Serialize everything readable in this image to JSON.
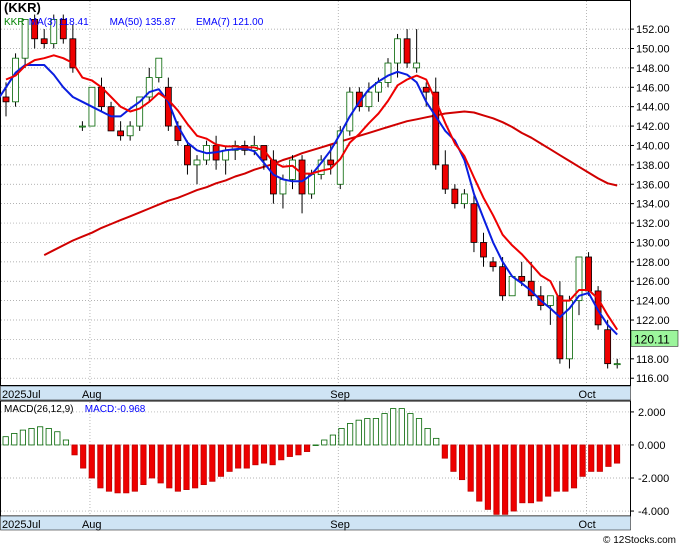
{
  "chart_data": [
    {
      "type": "candlestick",
      "title": "(KKR)",
      "symbol": "KKR",
      "legend": [
        {
          "label": "KKR",
          "color": "#008000"
        },
        {
          "label": "MA(3)",
          "value": "118.41",
          "color": "#0000ff"
        },
        {
          "label": "MA(50)",
          "value": "135.87",
          "color": "#0000ff"
        },
        {
          "label": "EMA(7)",
          "value": "121.00",
          "color": "#0000ff"
        }
      ],
      "last_price": "120.11",
      "y_ticks": [
        "152.00",
        "150.00",
        "148.00",
        "146.00",
        "144.00",
        "142.00",
        "140.00",
        "138.00",
        "136.00",
        "134.00",
        "132.00",
        "130.00",
        "128.00",
        "126.00",
        "124.00",
        "122.00",
        "120.00",
        "118.00",
        "116.00"
      ],
      "ylim": [
        115.3,
        155.0
      ],
      "x_labels": [
        {
          "label": "2025Jul",
          "i": 0
        },
        {
          "label": "Aug",
          "i": 9
        },
        {
          "label": "Sep",
          "i": 35
        },
        {
          "label": "Oct",
          "i": 61
        }
      ],
      "candles": [
        [
          145,
          146.5,
          143,
          144.5
        ],
        [
          144.5,
          149.5,
          144,
          149
        ],
        [
          149,
          153,
          148,
          153
        ],
        [
          153,
          153.5,
          150,
          151
        ],
        [
          151,
          152,
          150,
          150.5
        ],
        [
          150.5,
          153.5,
          150,
          153
        ],
        [
          153,
          153.5,
          150.5,
          151
        ],
        [
          151,
          152.5,
          147.5,
          148
        ],
        [
          142,
          142.5,
          141.5,
          142
        ],
        [
          142,
          146,
          142,
          146
        ],
        [
          146,
          147,
          143.5,
          144
        ],
        [
          144,
          144.5,
          141.5,
          141.5
        ],
        [
          141.5,
          142.5,
          140.5,
          141
        ],
        [
          141,
          142.5,
          140.5,
          142
        ],
        [
          142,
          145,
          141.5,
          145
        ],
        [
          145,
          148,
          144.5,
          147
        ],
        [
          147,
          149,
          146.5,
          149
        ],
        [
          146,
          147,
          141.5,
          142
        ],
        [
          142,
          142.5,
          140,
          140.5
        ],
        [
          140,
          140.5,
          137,
          138
        ],
        [
          138,
          139,
          136,
          138.5
        ],
        [
          138.5,
          140.5,
          138,
          140
        ],
        [
          140,
          141,
          137.5,
          138.5
        ],
        [
          138.5,
          140,
          137,
          139.5
        ],
        [
          139.5,
          140.5,
          138.5,
          140
        ],
        [
          140,
          140.5,
          139,
          139.5
        ],
        [
          139.5,
          141,
          139,
          140
        ],
        [
          140,
          140,
          137.5,
          138.5
        ],
        [
          138.5,
          139.5,
          134,
          135
        ],
        [
          135,
          137,
          133.5,
          136.5
        ],
        [
          136.5,
          139,
          135.5,
          138.5
        ],
        [
          138.5,
          139,
          133,
          135
        ],
        [
          135,
          137.5,
          134.5,
          137
        ],
        [
          137,
          139,
          136.5,
          138.5
        ],
        [
          138.5,
          140,
          137,
          138
        ],
        [
          136,
          142,
          135.5,
          141.5
        ],
        [
          141.5,
          146,
          141,
          145.5
        ],
        [
          145.5,
          146,
          143.5,
          144
        ],
        [
          144,
          146.5,
          143.5,
          145.5
        ],
        [
          145.5,
          147,
          144.5,
          146.5
        ],
        [
          146.5,
          149,
          146,
          148.5
        ],
        [
          148.5,
          151.5,
          147,
          151
        ],
        [
          151,
          152,
          148,
          148.5
        ],
        [
          148,
          152,
          147.5,
          148.5
        ],
        [
          146,
          146.5,
          144,
          145.5
        ],
        [
          145.5,
          147,
          137.5,
          138
        ],
        [
          138,
          139.5,
          135,
          135.5
        ],
        [
          135.5,
          136,
          133.5,
          134
        ],
        [
          134,
          135.5,
          133.5,
          135
        ],
        [
          134,
          135,
          129,
          130
        ],
        [
          130,
          131,
          127.5,
          128.5
        ],
        [
          128,
          128.5,
          127,
          127.5
        ],
        [
          127.5,
          128.5,
          124,
          124.5
        ],
        [
          124.5,
          126.5,
          124.5,
          126.5
        ],
        [
          126.5,
          128,
          125.5,
          126
        ],
        [
          126,
          128,
          124,
          124.5
        ],
        [
          124.5,
          125.5,
          123,
          123.5
        ],
        [
          123.5,
          124.5,
          121.5,
          124.5
        ],
        [
          124.5,
          126,
          117.5,
          118
        ],
        [
          118,
          124.5,
          117,
          124
        ],
        [
          124,
          128.5,
          122.5,
          128.5
        ],
        [
          128.5,
          129,
          124.5,
          125
        ],
        [
          125,
          125.5,
          121,
          121.5
        ],
        [
          121,
          122,
          117,
          117.5
        ],
        [
          117.5,
          118,
          117,
          117.5
        ]
      ],
      "ma3": [
        144.5,
        146,
        147.5,
        148.3,
        148.3,
        148.3,
        147.3,
        146,
        145,
        144.5,
        144,
        143.5,
        143,
        143,
        143.8,
        144.5,
        145.5,
        145.8,
        144.5,
        142,
        140.3,
        139.5,
        139.2,
        139.3,
        139.5,
        139.6,
        139.7,
        139.4,
        138.2,
        137,
        136.5,
        136.3,
        136.3,
        137,
        138.2,
        139.5,
        141.2,
        143,
        144.5,
        145.8,
        146.6,
        147.2,
        147.6,
        147.3,
        146.5,
        144.5,
        143,
        141.5,
        140.5,
        138.5,
        135,
        132.5,
        130,
        128,
        126.5,
        125.8,
        125,
        124,
        123.2,
        122.3,
        123.2,
        124.5,
        124.8,
        123,
        121.5,
        120.5
      ],
      "ma50": [
        128.7,
        129.2,
        129.7,
        130.2,
        130.6,
        131,
        131.5,
        131.9,
        132.3,
        132.7,
        133.1,
        133.5,
        133.9,
        134.3,
        134.6,
        135,
        135.4,
        135.7,
        136.1,
        136.4,
        136.8,
        137.1,
        137.5,
        137.8,
        138.1,
        138.5,
        138.8,
        139.2,
        139.5,
        139.8,
        140.1,
        140.4,
        140.7,
        141,
        141.3,
        141.6,
        141.9,
        142.2,
        142.5,
        142.7,
        142.9,
        143.1,
        143.3,
        143.4,
        143.5,
        143.4,
        143.1,
        142.8,
        142.4,
        141.9,
        141.3,
        140.8,
        140.2,
        139.6,
        139,
        138.4,
        137.8,
        137.2,
        136.6,
        136.1,
        135.87
      ],
      "ema7": [
        146.8,
        147.2,
        148.2,
        148.8,
        149,
        149.3,
        149,
        148.5,
        147,
        146.7,
        146,
        145,
        144,
        143.5,
        143.8,
        144.5,
        145.4,
        144.7,
        143.6,
        142.2,
        141,
        140.7,
        140.1,
        139.9,
        139.9,
        139.8,
        139.8,
        139.5,
        138.3,
        137.8,
        137.9,
        137.1,
        137.1,
        137.4,
        137.6,
        138.6,
        140.3,
        141.2,
        142.3,
        143.3,
        144.6,
        146.2,
        146.8,
        147.2,
        146.8,
        144.6,
        142.3,
        140.2,
        138.9,
        136.7,
        134.6,
        132.8,
        130.8,
        129.7,
        128.8,
        127.7,
        126.6,
        126,
        124,
        124,
        125.1,
        125.1,
        124.2,
        122.5,
        121
      ],
      "macd_legend": [
        {
          "label": "MACD(26,12,9)",
          "color": "#000000"
        },
        {
          "label": "MACD:-0.968",
          "color": "#0000ff"
        }
      ],
      "macd_ticks": [
        "2.000",
        "0.000",
        "-2.000",
        "-4.000"
      ],
      "macd_ylim": [
        -4.3,
        2.6
      ],
      "macd_x_labels": [
        {
          "label": "2025Jul",
          "i": 0
        },
        {
          "label": "Aug",
          "i": 9
        },
        {
          "label": "Sep",
          "i": 35
        },
        {
          "label": "Oct",
          "i": 61
        }
      ],
      "macd_hist": [
        0.5,
        0.7,
        0.9,
        1.0,
        1.1,
        1.0,
        0.8,
        0.3,
        -0.6,
        -1.4,
        -2.0,
        -2.6,
        -2.8,
        -2.9,
        -2.9,
        -2.8,
        -2.4,
        -2.0,
        -2.3,
        -2.6,
        -2.8,
        -2.7,
        -2.6,
        -2.4,
        -2.2,
        -1.9,
        -1.6,
        -1.4,
        -1.4,
        -1.2,
        -1.1,
        -1.2,
        -0.9,
        -0.7,
        -0.6,
        -0.4,
        0.0,
        0.3,
        0.6,
        1.0,
        1.3,
        1.5,
        1.6,
        1.6,
        1.9,
        2.2,
        2.2,
        1.9,
        1.6,
        1.0,
        0.4,
        -0.8,
        -1.6,
        -2.1,
        -2.8,
        -3.4,
        -3.9,
        -4.2,
        -4.2,
        -4.0,
        -3.5,
        -3.5,
        -3.4,
        -3.1,
        -2.8,
        -2.8,
        -2.6,
        -1.9,
        -1.6,
        -1.6,
        -1.3,
        -1.1
      ]
    }
  ],
  "watermark": "© 12Stocks.com"
}
